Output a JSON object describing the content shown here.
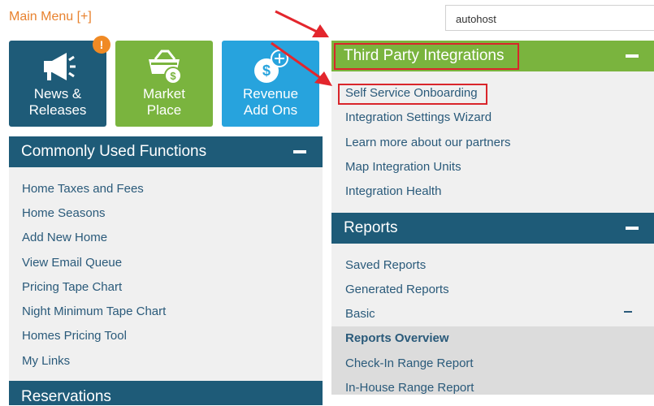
{
  "header": {
    "main_menu_label": "Main Menu [+]",
    "search_value": "autohost"
  },
  "tiles": [
    {
      "label_line1": "News &",
      "label_line2": "Releases",
      "icon": "megaphone-icon",
      "badge": "!"
    },
    {
      "label_line1": "Market",
      "label_line2": "Place",
      "icon": "basket-dollar-icon"
    },
    {
      "label_line1": "Revenue",
      "label_line2": "Add Ons",
      "icon": "dollar-plus-icon"
    }
  ],
  "common_functions": {
    "title": "Commonly Used Functions",
    "items": [
      "Home Taxes and Fees",
      "Home Seasons",
      "Add New Home",
      "View Email Queue",
      "Pricing Tape Chart",
      "Night Minimum Tape Chart",
      "Homes Pricing Tool",
      "My Links"
    ]
  },
  "reservations": {
    "title": "Reservations"
  },
  "third_party": {
    "title": "Third Party Integrations",
    "items": [
      "Self Service Onboarding",
      "Integration Settings Wizard",
      "Learn more about our partners",
      "Map Integration Units",
      "Integration Health"
    ]
  },
  "reports": {
    "title": "Reports",
    "items": [
      "Saved Reports",
      "Generated Reports",
      "Basic"
    ],
    "sub_items": [
      "Reports Overview",
      "Check-In Range Report",
      "In-House Range Report"
    ]
  },
  "colors": {
    "navy": "#1e5b78",
    "green": "#7ab43e",
    "blue": "#27a3dd",
    "orange": "#f08a24",
    "annotation_red": "#d9252b"
  }
}
